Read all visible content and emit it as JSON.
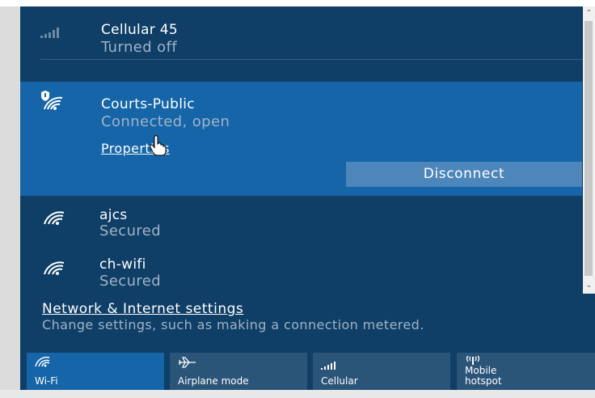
{
  "networks": [
    {
      "name": "Cellular 45",
      "status": "Turned off",
      "icon": "cellular-signal-icon"
    },
    {
      "name": "Courts-Public",
      "status": "Connected, open",
      "icon": "wifi-secured-shield-icon",
      "properties_label": "Properties",
      "disconnect_label": "Disconnect"
    },
    {
      "name": "ajcs",
      "status": "Secured",
      "icon": "wifi-icon"
    },
    {
      "name": "ch-wifi",
      "status": "Secured",
      "icon": "wifi-icon"
    }
  ],
  "settings": {
    "link_label": "Network & Internet settings",
    "description": "Change settings, such as making a connection metered."
  },
  "quick_actions": [
    {
      "label": "Wi-Fi",
      "icon": "wifi-icon",
      "active": true
    },
    {
      "label": "Airplane mode",
      "icon": "airplane-icon",
      "active": false
    },
    {
      "label": "Cellular",
      "icon": "cellular-signal-icon",
      "active": false
    },
    {
      "label": "Mobile hotspot",
      "icon": "mobile-hotspot-icon",
      "active": false
    }
  ],
  "colors": {
    "panel_background": "#0f3e66",
    "selected_background": "#1565a8",
    "active_tile": "#1565a8",
    "inactive_tile": "#2b5479",
    "button_background": "#4d86bb"
  }
}
